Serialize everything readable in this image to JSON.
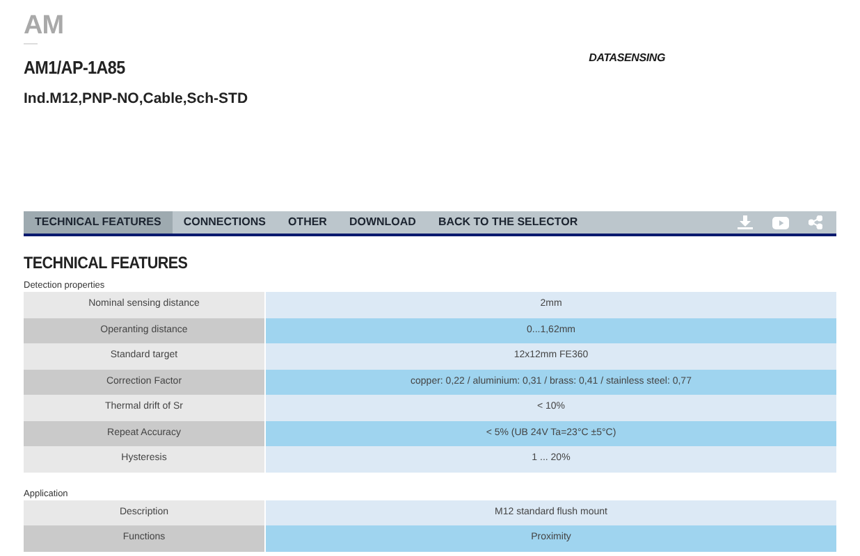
{
  "header": {
    "series": "AM",
    "model": "AM1/AP-1A85",
    "description": "Ind.M12,PNP-NO,Cable,Sch-STD",
    "logo": "DATASENSING"
  },
  "tabs": [
    {
      "label": "TECHNICAL FEATURES",
      "selected": true
    },
    {
      "label": "CONNECTIONS",
      "selected": false
    },
    {
      "label": "OTHER",
      "selected": false
    },
    {
      "label": "DOWNLOAD",
      "selected": false
    },
    {
      "label": "BACK TO THE SELECTOR",
      "selected": false
    }
  ],
  "heading": "TECHNICAL FEATURES",
  "sections": [
    {
      "title": "Detection properties",
      "rows": [
        {
          "label": "Nominal sensing distance",
          "value": "2mm"
        },
        {
          "label": "Operanting distance",
          "value": "0...1,62mm"
        },
        {
          "label": "Standard target",
          "value": "12x12mm FE360"
        },
        {
          "label": "Correction Factor",
          "value": "copper: 0,22 / aluminium: 0,31 / brass: 0,41 / stainless steel: 0,77"
        },
        {
          "label": "Thermal drift of Sr",
          "value": "< 10%"
        },
        {
          "label": "Repeat Accuracy",
          "value": "< 5% (UB 24V Ta=23°C ±5°C)"
        },
        {
          "label": "Hysteresis",
          "value": "1 ... 20%"
        }
      ]
    },
    {
      "title": "Application",
      "rows": [
        {
          "label": "Description",
          "value": "M12 standard flush mount"
        },
        {
          "label": "Functions",
          "value": "Proximity"
        }
      ]
    }
  ]
}
